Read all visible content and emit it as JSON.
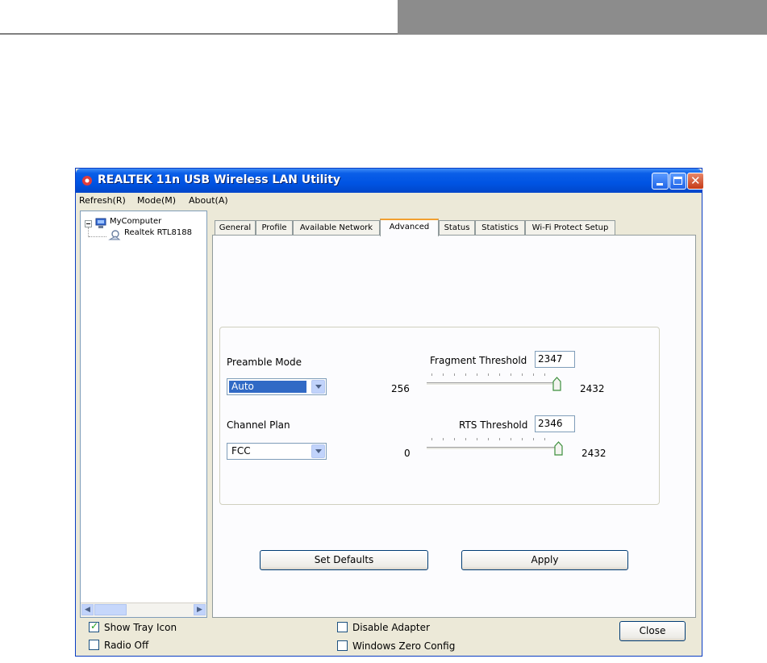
{
  "window": {
    "title": "REALTEK 11n USB Wireless LAN Utility"
  },
  "menu": [
    "Refresh(R)",
    "Mode(M)",
    "About(A)"
  ],
  "tree": {
    "root": "MyComputer",
    "child": "Realtek RTL8188"
  },
  "tabs": [
    {
      "label": "General",
      "active": false
    },
    {
      "label": "Profile",
      "active": false
    },
    {
      "label": "Available Network",
      "active": false
    },
    {
      "label": "Advanced",
      "active": true
    },
    {
      "label": "Status",
      "active": false
    },
    {
      "label": "Statistics",
      "active": false
    },
    {
      "label": "Wi-Fi Protect Setup",
      "active": false
    }
  ],
  "advanced": {
    "preamble_label": "Preamble Mode",
    "preamble_value": "Auto",
    "channel_label": "Channel Plan",
    "channel_value": "FCC",
    "fragment": {
      "label": "Fragment Threshold",
      "value": "2347",
      "min": "256",
      "max": "2432"
    },
    "rts": {
      "label": "RTS Threshold",
      "value": "2346",
      "min": "0",
      "max": "2432"
    },
    "set_defaults": "Set Defaults",
    "apply": "Apply"
  },
  "footer": {
    "show_tray_icon": "Show Tray Icon",
    "show_tray_checked": true,
    "radio_off": "Radio Off",
    "radio_off_checked": false,
    "disable_adapter": "Disable Adapter",
    "disable_adapter_checked": false,
    "windows_zero_config": "Windows Zero Config",
    "windows_zero_config_checked": false,
    "close": "Close"
  },
  "colors": {
    "titlebar": "#0054e3",
    "selection": "#316ac5",
    "active_tab_accent": "#f2a030"
  }
}
